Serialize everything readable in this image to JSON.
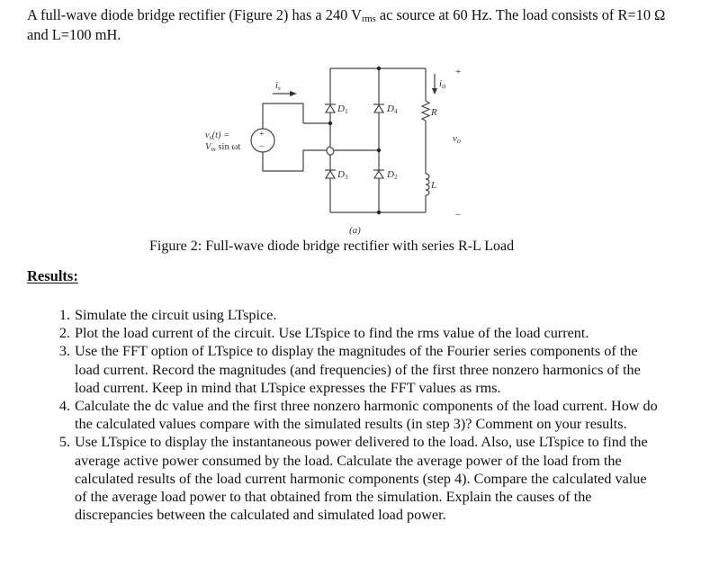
{
  "intro": {
    "text_before_sub": "A full-wave diode bridge rectifier (Figure 2) has a 240 V",
    "sub": "rms",
    "text_after_sub": " ac source at 60 Hz.  The load consists of R=10 Ω and L=100 mH."
  },
  "figure": {
    "source_label_line1": "v",
    "source_label_line1_sub": "s",
    "source_label_line1_rest": "(t) =",
    "source_label_line2": "V",
    "source_label_line2_sub": "m",
    "source_label_line2_rest": " sin ωt",
    "source_current": "i",
    "source_current_sub": "s",
    "load_current": "i",
    "load_current_sub": "o",
    "output_voltage": "v",
    "output_voltage_sub": "o",
    "plus": "+",
    "minus": "−",
    "source_plus": "+",
    "source_minus": "−",
    "diodes": [
      {
        "name": "D",
        "sub": "1"
      },
      {
        "name": "D",
        "sub": "4"
      },
      {
        "name": "D",
        "sub": "3"
      },
      {
        "name": "D",
        "sub": "2"
      }
    ],
    "resistor": "R",
    "inductor": "L",
    "subfigure_label": "(a)",
    "caption": "Figure 2: Full-wave diode bridge rectifier with series R-L Load"
  },
  "results": {
    "heading": "Results:",
    "steps": [
      "Simulate the circuit using LTspice.",
      "Plot the load current of the circuit.  Use LTspice to find the rms value of the load current.",
      "Use the FFT option of LTspice to display the magnitudes of the Fourier series components of the load current.  Record the magnitudes (and frequencies) of the first three nonzero harmonics of the load current.  Keep in mind that LTspice expresses the FFT values as rms.",
      "Calculate the dc value and the first three nonzero harmonic components of the load current.   How do the calculated values compare with the simulated results (in step 3)? Comment on your results.",
      "Use LTspice to display the instantaneous power delivered to the load.  Also, use LTspice to find the average active power consumed by the load.  Calculate the average power of the load from the calculated results of the load current harmonic components (step 4).  Compare the calculated value of the average load power to that obtained from the simulation.  Explain the causes of the discrepancies between the calculated and simulated load power."
    ]
  }
}
